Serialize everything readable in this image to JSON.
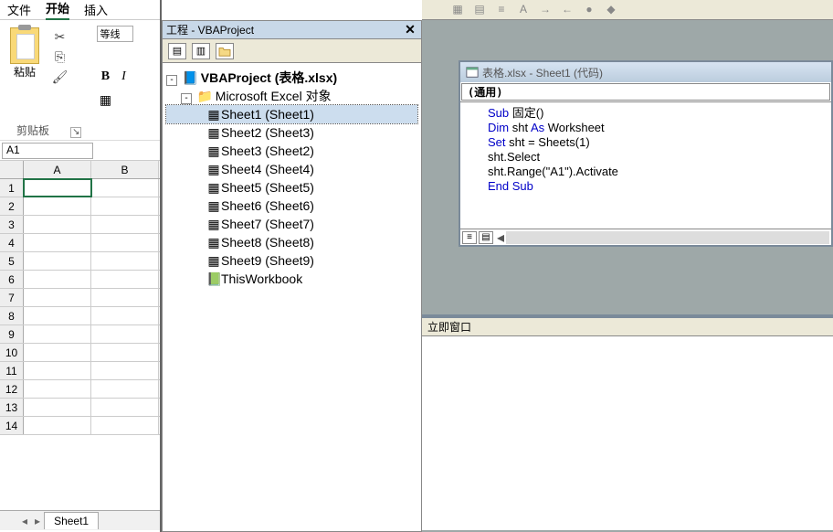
{
  "ribbon": {
    "tabs": {
      "file": "文件",
      "home": "开始",
      "insert": "插入"
    },
    "paste_label": "粘贴",
    "clipboard_group_label": "剪贴板",
    "font_combo": "等线",
    "namebox": "A1"
  },
  "columns": [
    "A",
    "B"
  ],
  "rows": [
    "1",
    "2",
    "3",
    "4",
    "5",
    "6",
    "7",
    "8",
    "9",
    "10",
    "11",
    "12",
    "13",
    "14"
  ],
  "sheet_tab": "Sheet1",
  "vba": {
    "panel_title": "工程 - VBAProject",
    "root": "VBAProject (表格.xlsx)",
    "folder": "Microsoft Excel 对象",
    "items": [
      "Sheet1 (Sheet1)",
      "Sheet2 (Sheet3)",
      "Sheet3 (Sheet2)",
      "Sheet4 (Sheet4)",
      "Sheet5 (Sheet5)",
      "Sheet6 (Sheet6)",
      "Sheet7 (Sheet7)",
      "Sheet8 (Sheet8)",
      "Sheet9 (Sheet9)",
      "ThisWorkbook"
    ]
  },
  "code_window": {
    "title": "表格.xlsx - Sheet1 (代码)",
    "combo_left": "(通用)",
    "lines": [
      {
        "kw1": "Sub",
        "rest": " 固定()"
      },
      {
        "kw1": "Dim",
        "rest": " sht ",
        "kw2": "As",
        "rest2": " Worksheet"
      },
      {
        "kw1": "Set",
        "rest": " sht = Sheets(1)"
      },
      {
        "plain": "sht.Select"
      },
      {
        "plain": "sht.Range(\"A1\").Activate"
      },
      {
        "kw1": "End Sub",
        "rest": ""
      }
    ]
  },
  "immediate_title": "立即窗口"
}
